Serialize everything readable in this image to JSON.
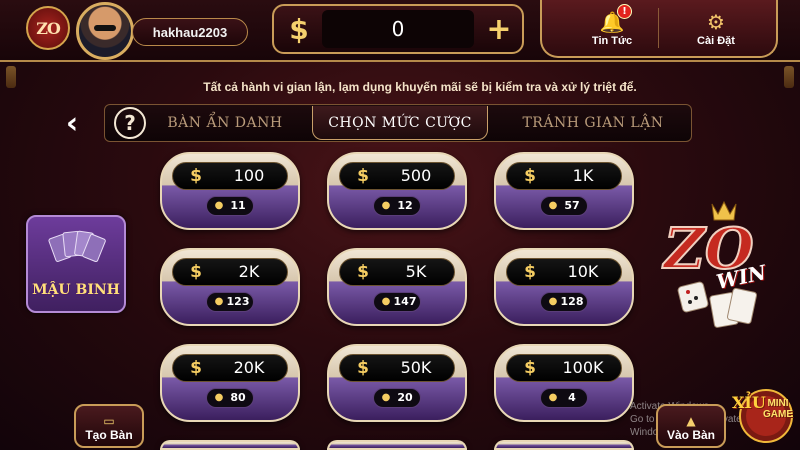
{
  "header": {
    "logo_text": "ZO",
    "username": "hakhau2203",
    "currency_symbol": "$",
    "balance": "0",
    "add_symbol": "+",
    "news_label": "Tin Tức",
    "news_badge": "!",
    "settings_label": "Cài Đặt"
  },
  "notice": "Tất cả hành vi gian lận, lạm dụng khuyến mãi sẽ bị kiểm tra và xử lý triệt để.",
  "tabs": {
    "help": "?",
    "anon": "BÀN ẨN DANH",
    "select": "CHỌN MỨC CƯỢC",
    "cheat": "TRÁNH GIAN LẬN"
  },
  "bets": [
    {
      "amount": "100",
      "players": "11"
    },
    {
      "amount": "500",
      "players": "12"
    },
    {
      "amount": "1K",
      "players": "57"
    },
    {
      "amount": "2K",
      "players": "123"
    },
    {
      "amount": "5K",
      "players": "147"
    },
    {
      "amount": "10K",
      "players": "128"
    },
    {
      "amount": "20K",
      "players": "80"
    },
    {
      "amount": "50K",
      "players": "20"
    },
    {
      "amount": "100K",
      "players": "4"
    }
  ],
  "game_card": {
    "label": "MẬU BINH"
  },
  "brand": {
    "logo": "ZO",
    "win": "WIN"
  },
  "buttons": {
    "create": "Tạo Bàn",
    "join": "Vào Bàn"
  },
  "watermark": {
    "line1": "Activate Windows",
    "line2": "Go to Settings to activate Windows."
  },
  "mini_game": {
    "title": "XỈU",
    "subtitle": "MINI GAME"
  },
  "colors": {
    "gold": "#f5cd62",
    "background": "#2a0a0e",
    "purple": "#5a2f86"
  }
}
